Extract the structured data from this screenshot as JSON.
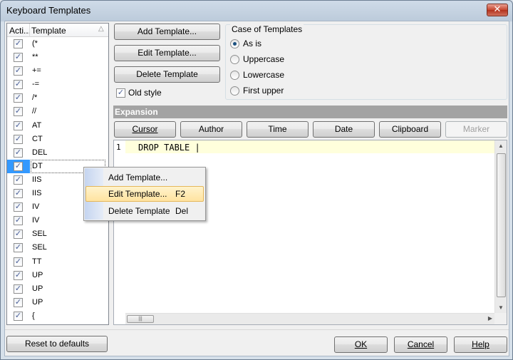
{
  "window": {
    "title": "Keyboard Templates",
    "close_glyph": "✕"
  },
  "list": {
    "col_active": "Acti...",
    "col_template": "Template",
    "sort_glyph": "△",
    "rows": [
      {
        "label": "(*",
        "checked": true
      },
      {
        "label": "**",
        "checked": true
      },
      {
        "label": "+=",
        "checked": true
      },
      {
        "label": "-=",
        "checked": true
      },
      {
        "label": "/*",
        "checked": true
      },
      {
        "label": "//",
        "checked": true
      },
      {
        "label": "AT",
        "checked": true
      },
      {
        "label": "CT",
        "checked": true
      },
      {
        "label": "DEL",
        "checked": true
      },
      {
        "label": "DT",
        "checked": true,
        "selected": true
      },
      {
        "label": "IIS",
        "checked": true
      },
      {
        "label": "IIS",
        "checked": true
      },
      {
        "label": "IV",
        "checked": true
      },
      {
        "label": "IV",
        "checked": true
      },
      {
        "label": "SEL",
        "checked": true
      },
      {
        "label": "SEL",
        "checked": true
      },
      {
        "label": "TT",
        "checked": true
      },
      {
        "label": "UP",
        "checked": true
      },
      {
        "label": "UP",
        "checked": true
      },
      {
        "label": "UP",
        "checked": true
      },
      {
        "label": "{",
        "checked": true
      }
    ]
  },
  "buttons": {
    "add": "Add Template...",
    "edit": "Edit Template...",
    "delete": "Delete Template",
    "reset": "Reset to defaults",
    "ok": "OK",
    "cancel": "Cancel",
    "help": "Help"
  },
  "old_style": {
    "label": "Old style",
    "checked": true
  },
  "case_group": {
    "title": "Case of Templates",
    "options": [
      "As is",
      "Uppercase",
      "Lowercase",
      "First upper"
    ],
    "selected": "As is"
  },
  "expansion": {
    "title": "Expansion",
    "buttons": {
      "cursor": "Cursor",
      "author": "Author",
      "time": "Time",
      "date": "Date",
      "clipboard": "Clipboard",
      "marker": "Marker"
    },
    "line_number": "1",
    "code": "DROP TABLE |"
  },
  "context_menu": {
    "items": [
      {
        "label": "Add Template...",
        "shortcut": ""
      },
      {
        "label": "Edit Template...",
        "shortcut": "F2",
        "highlighted": true
      },
      {
        "label": "Delete Template",
        "shortcut": "Del"
      }
    ]
  },
  "icons": {
    "check": "✓",
    "up_arrow": "▲",
    "down_arrow": "▼",
    "left_arrow": "◀",
    "right_arrow": "▶",
    "grip": "|||"
  }
}
